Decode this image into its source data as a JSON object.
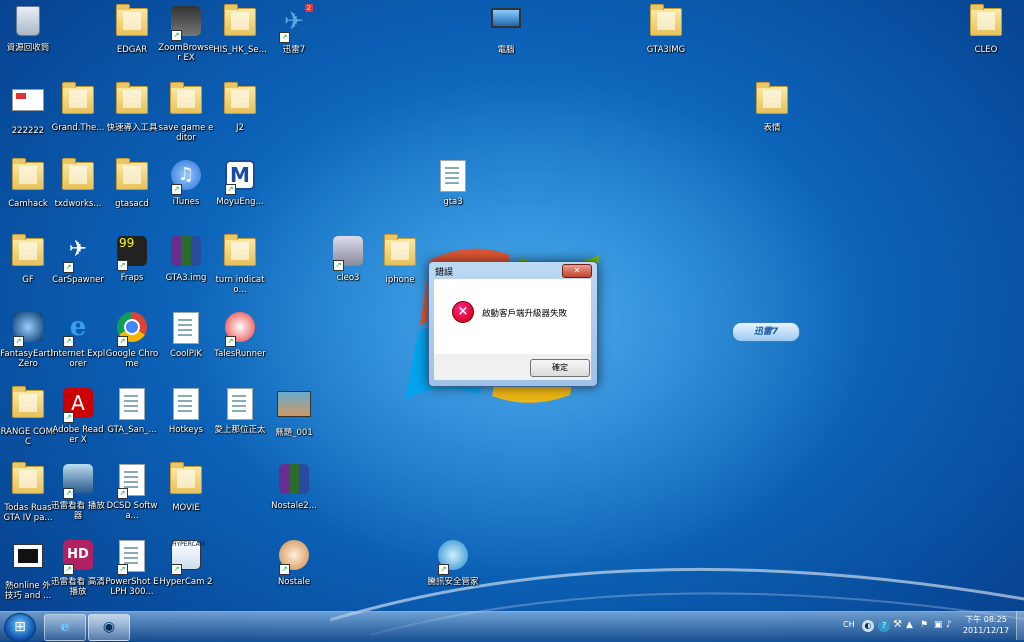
{
  "desktop_icons": [
    {
      "label": "資源回收筒",
      "icon": "recycle-bin-icon"
    },
    {
      "label": "EDGAR",
      "icon": "folder-icon"
    },
    {
      "label": "ZoomBrowser EX",
      "icon": "zoombrowser-icon"
    },
    {
      "label": "HIS_HK_Se...",
      "icon": "folder-icon"
    },
    {
      "label": "迅雷7",
      "icon": "xunlei-icon",
      "badge": "2"
    },
    {
      "label": "電腦",
      "icon": "computer-icon"
    },
    {
      "label": "GTA3IMG",
      "icon": "folder-icon"
    },
    {
      "label": "CLEO",
      "icon": "folder-icon"
    },
    {
      "label": "222222",
      "icon": "image-file-icon"
    },
    {
      "label": "Grand.The...",
      "icon": "folder-icon"
    },
    {
      "label": "快速導入工具",
      "icon": "folder-icon"
    },
    {
      "label": "save game editor",
      "icon": "folder-icon"
    },
    {
      "label": "J2",
      "icon": "folder-icon"
    },
    {
      "label": "表情",
      "icon": "folder-icon"
    },
    {
      "label": "Camhack",
      "icon": "folder-icon"
    },
    {
      "label": "txdworks...",
      "icon": "folder-icon"
    },
    {
      "label": "gtasacd",
      "icon": "folder-icon"
    },
    {
      "label": "iTunes",
      "icon": "itunes-icon"
    },
    {
      "label": "MoyuEng...",
      "icon": "moyu-icon"
    },
    {
      "label": "gta3",
      "icon": "file-icon"
    },
    {
      "label": "GF",
      "icon": "folder-icon"
    },
    {
      "label": "CarSpawner",
      "icon": "carspawner-icon"
    },
    {
      "label": "Fraps",
      "icon": "fraps-icon"
    },
    {
      "label": "GTA3.img",
      "icon": "winrar-icon"
    },
    {
      "label": "turn indicato...",
      "icon": "folder-icon"
    },
    {
      "label": "cleo3",
      "icon": "installer-icon"
    },
    {
      "label": "iphone",
      "icon": "folder-icon"
    },
    {
      "label": "FantasyEarth Zero",
      "icon": "fantasyearth-icon"
    },
    {
      "label": "Internet Explorer",
      "icon": "ie-icon"
    },
    {
      "label": "Google Chrome",
      "icon": "chrome-icon"
    },
    {
      "label": "CoolPIK",
      "icon": "file-icon"
    },
    {
      "label": "TalesRunner",
      "icon": "talesrunner-icon"
    },
    {
      "label": "RANGE COMIC",
      "icon": "folder-icon"
    },
    {
      "label": "Adobe Reader X",
      "icon": "adobe-reader-icon"
    },
    {
      "label": "GTA_San_...",
      "icon": "mp3-icon"
    },
    {
      "label": "Hotkeys",
      "icon": "file-icon"
    },
    {
      "label": "愛上那位正太",
      "icon": "mp3-icon"
    },
    {
      "label": "無題_001",
      "icon": "image-file-icon"
    },
    {
      "label": "Todas Ruas GTA IV pa...",
      "icon": "folder-icon"
    },
    {
      "label": "迅雷看看 播放器",
      "icon": "xunlei-player-icon"
    },
    {
      "label": "DCSD Softwa...",
      "icon": "pdf-icon"
    },
    {
      "label": "MOVIE",
      "icon": "folder-icon"
    },
    {
      "label": "Nostale2...",
      "icon": "winrar-icon"
    },
    {
      "label": "熱online 外 技巧 and ...",
      "icon": "video-icon"
    },
    {
      "label": "迅雷看看 高清播放",
      "icon": "hd-player-icon"
    },
    {
      "label": "PowerShot ELPH 300...",
      "icon": "pdf-icon"
    },
    {
      "label": "HyperCam 2",
      "icon": "hypercam-icon"
    },
    {
      "label": "Nostale",
      "icon": "nostale-icon"
    },
    {
      "label": "騰訊安全管家",
      "icon": "tencent-security-icon"
    }
  ],
  "dialog": {
    "title": "錯誤",
    "close": "✕",
    "message": "啟動客戶端升級器失敗",
    "ok_label": "確定"
  },
  "float_widget": {
    "label": "迅雷7"
  },
  "taskbar": {
    "language": "CH",
    "time": "下午 08:25",
    "date": "2011/12/17"
  }
}
